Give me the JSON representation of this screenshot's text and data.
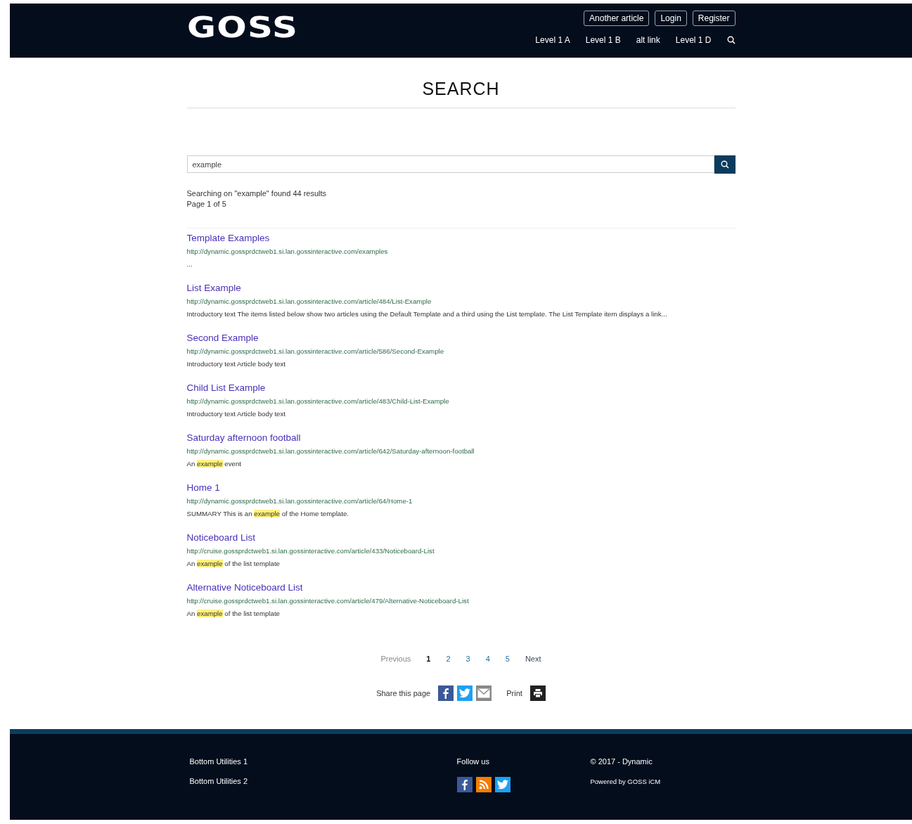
{
  "header": {
    "logo": "GOSS",
    "utility_links": [
      "Another article",
      "Login",
      "Register"
    ],
    "nav_links": [
      "Level 1 A",
      "Level 1 B",
      "alt link",
      "Level 1 D"
    ]
  },
  "page_title": "SEARCH",
  "search": {
    "value": "example"
  },
  "summary": [
    "Searching on \"example\" found 44 results",
    "Page 1 of 5"
  ],
  "results": [
    {
      "title": "Template Examples",
      "url": "http://dynamic.gossprdctweb1.si.lan.gossinteractive.com/examples",
      "description": [
        {
          "text": "...",
          "highlight": false
        }
      ]
    },
    {
      "title": "List Example",
      "url": "http://dynamic.gossprdctweb1.si.lan.gossinteractive.com/article/484/List-Example",
      "description": [
        {
          "text": "Introductory text The items listed below show two articles using the Default Template and a third using the List template. The List Template item displays a link...",
          "highlight": false
        }
      ]
    },
    {
      "title": "Second Example",
      "url": "http://dynamic.gossprdctweb1.si.lan.gossinteractive.com/article/586/Second-Example",
      "description": [
        {
          "text": "Introductory text Article body text",
          "highlight": false
        }
      ]
    },
    {
      "title": "Child List Example",
      "url": "http://dynamic.gossprdctweb1.si.lan.gossinteractive.com/article/483/Child-List-Example",
      "description": [
        {
          "text": "Introductory text Article body text",
          "highlight": false
        }
      ]
    },
    {
      "title": "Saturday afternoon football",
      "url": "http://dynamic.gossprdctweb1.si.lan.gossinteractive.com/article/642/Saturday-afternoon-football",
      "description": [
        {
          "text": "An ",
          "highlight": false
        },
        {
          "text": "example",
          "highlight": true
        },
        {
          "text": " event",
          "highlight": false
        }
      ]
    },
    {
      "title": "Home 1",
      "url": "http://dynamic.gossprdctweb1.si.lan.gossinteractive.com/article/64/Home-1",
      "description": [
        {
          "text": "SUMMARY This is an ",
          "highlight": false
        },
        {
          "text": "example",
          "highlight": true
        },
        {
          "text": " of the Home template.",
          "highlight": false
        }
      ]
    },
    {
      "title": "Noticeboard List",
      "url": "http://cruise.gossprdctweb1.si.lan.gossinteractive.com/article/433/Noticeboard-List",
      "description": [
        {
          "text": "An ",
          "highlight": false
        },
        {
          "text": "example",
          "highlight": true
        },
        {
          "text": " of the list template",
          "highlight": false
        }
      ]
    },
    {
      "title": "Alternative Noticeboard List",
      "url": "http://cruise.gossprdctweb1.si.lan.gossinteractive.com/article/479/Alternative-Noticeboard-List",
      "description": [
        {
          "text": "An ",
          "highlight": false
        },
        {
          "text": "example",
          "highlight": true
        },
        {
          "text": " of the list template",
          "highlight": false
        }
      ]
    }
  ],
  "pagination": {
    "previous": {
      "label": "Previous",
      "disabled": true
    },
    "pages": [
      {
        "label": "1",
        "selected": true
      },
      {
        "label": "2",
        "selected": false
      },
      {
        "label": "3",
        "selected": false
      },
      {
        "label": "4",
        "selected": false
      },
      {
        "label": "5",
        "selected": false
      }
    ],
    "next": {
      "label": "Next",
      "disabled": false
    }
  },
  "share": {
    "label": "Share this page",
    "print_label": "Print"
  },
  "footer": {
    "links": [
      "Bottom Utilities 1",
      "Bottom Utilities 2"
    ],
    "follow_label": "Follow us",
    "copyright": "© 2017 - Dynamic",
    "powered_by": "Powered by GOSS iCM"
  }
}
